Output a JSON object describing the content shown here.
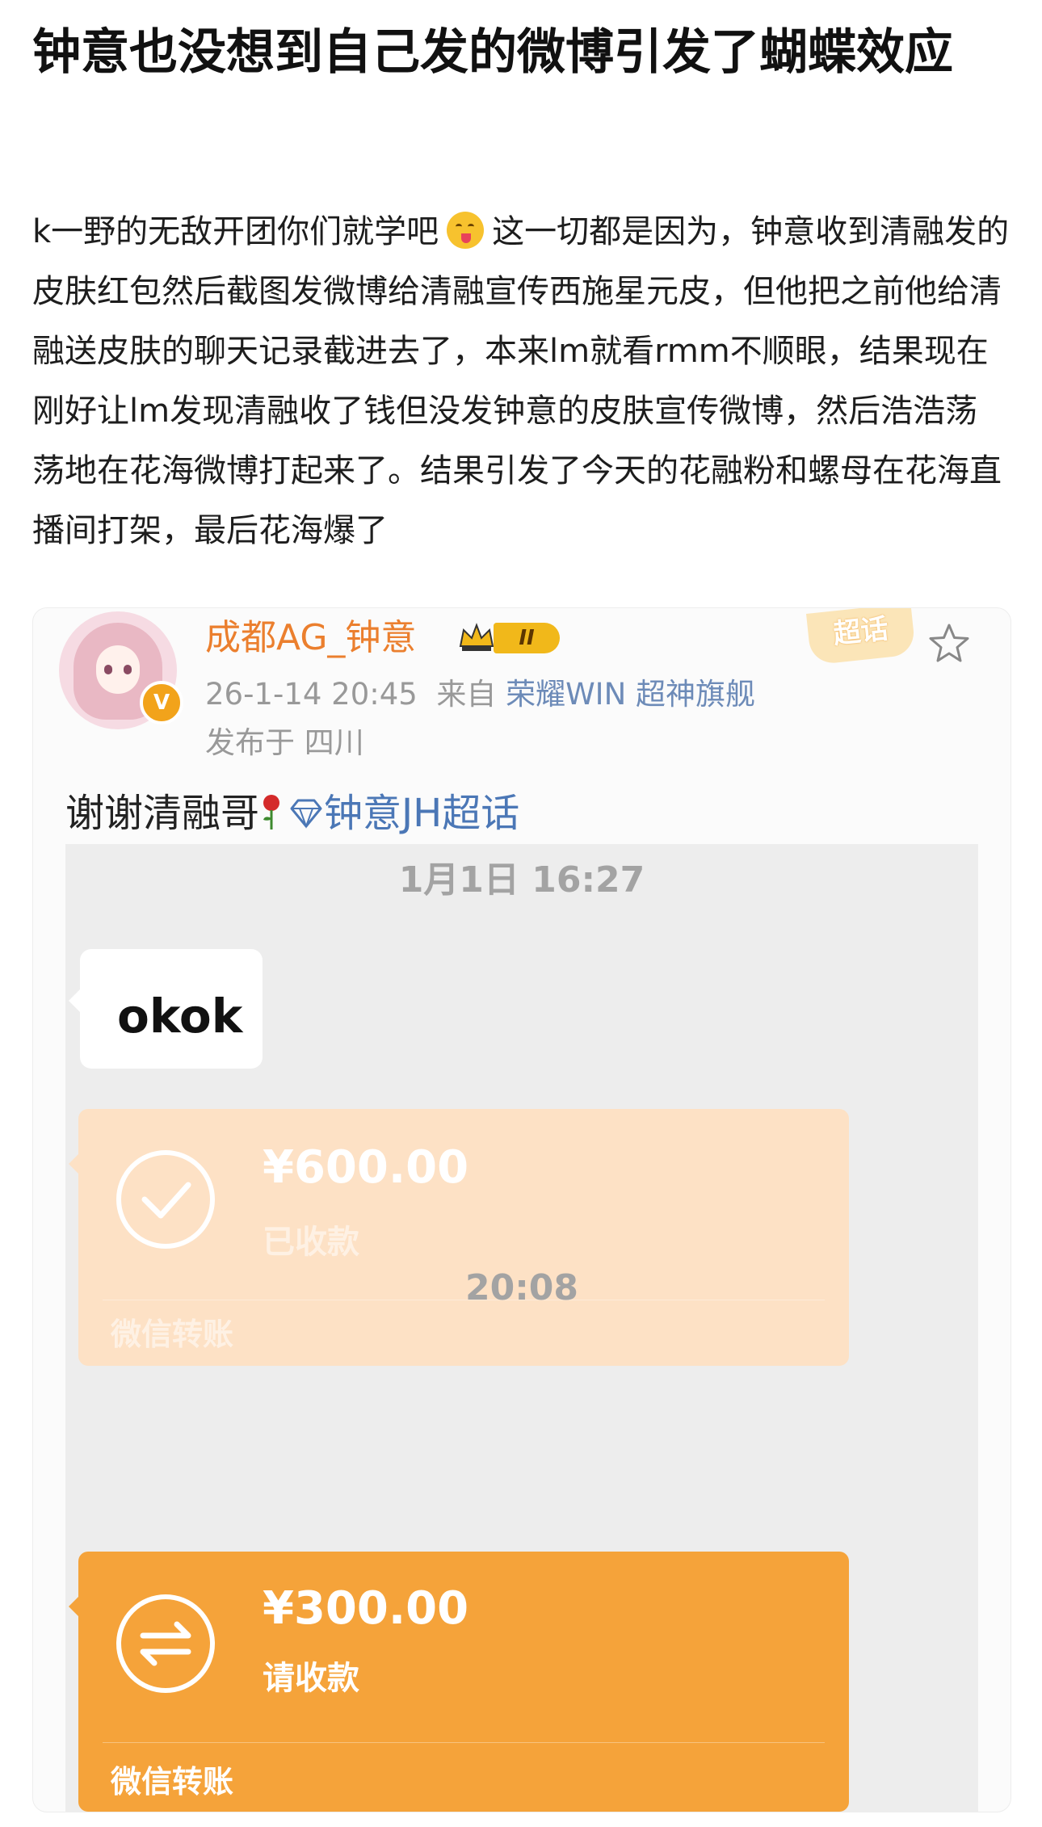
{
  "article": {
    "title": "钟意也没想到自己发的微博引发了蝴蝶效应",
    "body_part1": "k一野的无敌开团你们就学吧",
    "emoji_icon": "face-savoring-food-emoji",
    "body_part2": "这一切都是因为，钟意收到清融发的皮肤红包然后截图发微博给清融宣传西施星元皮，但他把之前他给清融送皮肤的聊天记录截进去了，本来lm就看rmm不顺眼，结果现在刚好让lm发现清融收了钱但没发钟意的皮肤宣传微博，然后浩浩荡荡地在花海微博打起来了。结果引发了今天的花融粉和螺母在花海直播间打架，最后花海爆了"
  },
  "post": {
    "username": "成都AG_钟意",
    "verify_badge": "V",
    "level_badge": "II",
    "supertopic_tag": "超话",
    "date_time": "26-1-14 20:45",
    "from_label": "来自",
    "device": "荣耀WIN 超神旗舰",
    "location": "发布于 四川",
    "text": "谢谢清融哥",
    "topic": "钟意JH超话",
    "colors": {
      "username": "#eb7f2e",
      "topic_link": "#4b77b6",
      "badge_gold": "#f1b81a"
    }
  },
  "chat": {
    "time1": "1月1日 16:27",
    "message": "okok",
    "transfer1": {
      "amount": "¥600.00",
      "status": "已收款",
      "footer": "微信转账",
      "color": "#fde1c5"
    },
    "time2": "20:08",
    "transfer2": {
      "amount": "¥300.00",
      "status": "请收款",
      "footer": "微信转账",
      "color": "#f5a33a"
    }
  }
}
